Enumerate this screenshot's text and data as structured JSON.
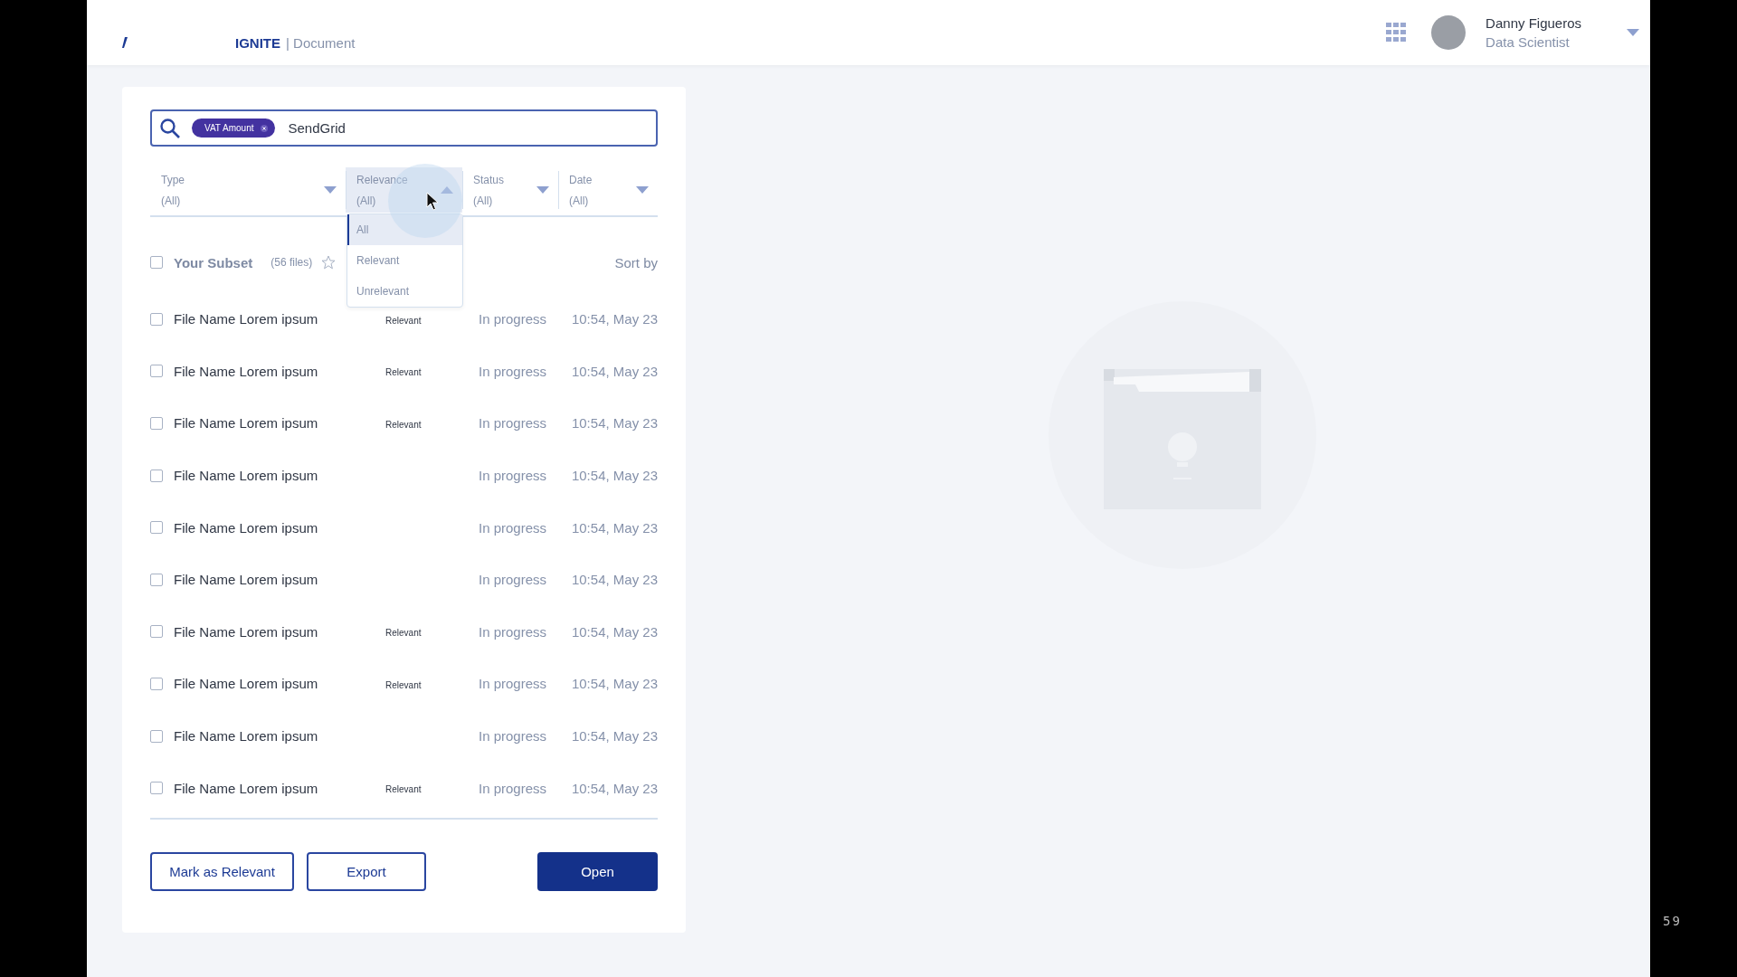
{
  "header": {
    "brand": "IGNITE",
    "section": "| Document",
    "user": {
      "name": "Danny Figueros",
      "role": "Data Scientist"
    }
  },
  "search": {
    "tags": [
      "VAT Amount"
    ],
    "value": "SendGrid"
  },
  "filters": [
    {
      "label": "Type",
      "value": "(All)",
      "open": false
    },
    {
      "label": "Relevance",
      "value": "(All)",
      "open": true
    },
    {
      "label": "Status",
      "value": "(All)",
      "open": false
    },
    {
      "label": "Date",
      "value": "(All)",
      "open": false
    }
  ],
  "relevance_menu": [
    {
      "label": "All",
      "selected": true
    },
    {
      "label": "Relevant",
      "selected": false
    },
    {
      "label": "Unrelevant",
      "selected": false
    }
  ],
  "subset": {
    "title": "Your Subset",
    "count": "(56 files)",
    "checked": false,
    "starred": false,
    "sort_label": "Sort by"
  },
  "files": [
    {
      "name": "File Name Lorem ipsum",
      "relevance": "Relevant",
      "status": "In progress",
      "time": "10:54, May 23",
      "checked": false
    },
    {
      "name": "File Name Lorem ipsum",
      "relevance": "Relevant",
      "status": "In progress",
      "time": "10:54, May 23",
      "checked": false
    },
    {
      "name": "File Name Lorem ipsum",
      "relevance": "Relevant",
      "status": "In progress",
      "time": "10:54, May 23",
      "checked": false
    },
    {
      "name": "File Name Lorem ipsum",
      "status": "In progress",
      "time": "10:54, May 23",
      "checked": false
    },
    {
      "name": "File Name Lorem ipsum",
      "status": "In progress",
      "time": "10:54, May 23",
      "checked": false
    },
    {
      "name": "File Name Lorem ipsum",
      "status": "In progress",
      "time": "10:54, May 23",
      "checked": false
    },
    {
      "name": "File Name Lorem ipsum",
      "relevance": "Relevant",
      "status": "In progress",
      "time": "10:54, May 23",
      "checked": false
    },
    {
      "name": "File Name Lorem ipsum",
      "relevance": "Relevant",
      "status": "In progress",
      "time": "10:54, May 23",
      "checked": false
    },
    {
      "name": "File Name Lorem ipsum",
      "status": "In progress",
      "time": "10:54, May 23",
      "checked": false
    },
    {
      "name": "File Name Lorem ipsum",
      "relevance": "Relevant",
      "status": "In progress",
      "time": "10:54, May 23",
      "checked": false
    }
  ],
  "actions": [
    {
      "label": "Mark as Relevant",
      "kind": "outline"
    },
    {
      "label": "Export",
      "kind": "outline"
    },
    {
      "label": "Open",
      "kind": "primary"
    }
  ],
  "frame_number": "59"
}
